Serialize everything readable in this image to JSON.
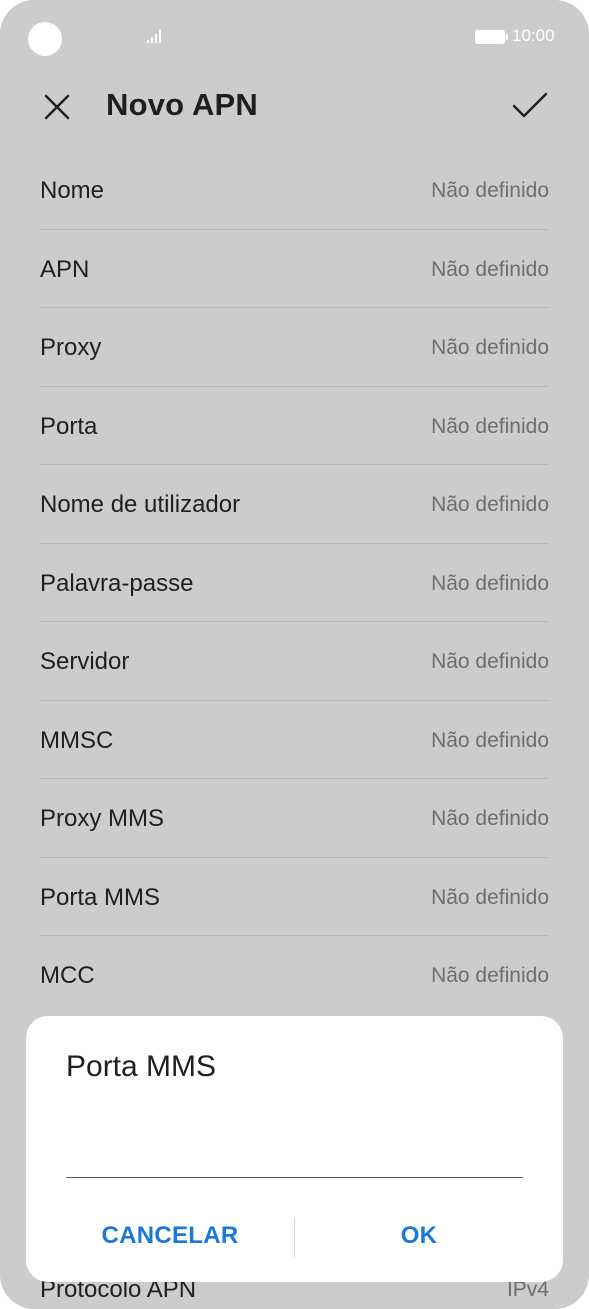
{
  "status_bar": {
    "time": "10:00",
    "signal_icon": "signal-bars-icon",
    "battery_icon": "battery-icon"
  },
  "header": {
    "title": "Novo APN",
    "close_icon": "close-icon",
    "confirm_icon": "checkmark-icon"
  },
  "apn_fields": [
    {
      "label": "Nome",
      "value": "Não definido"
    },
    {
      "label": "APN",
      "value": "Não definido"
    },
    {
      "label": "Proxy",
      "value": "Não definido"
    },
    {
      "label": "Porta",
      "value": "Não definido"
    },
    {
      "label": "Nome de utilizador",
      "value": "Não definido"
    },
    {
      "label": "Palavra-passe",
      "value": "Não definido"
    },
    {
      "label": "Servidor",
      "value": "Não definido"
    },
    {
      "label": "MMSC",
      "value": "Não definido"
    },
    {
      "label": "Proxy MMS",
      "value": "Não definido"
    },
    {
      "label": "Porta MMS",
      "value": "Não definido"
    },
    {
      "label": "MCC",
      "value": "Não definido"
    }
  ],
  "bottom_field": {
    "label": "Protocolo APN",
    "value": "IPv4"
  },
  "dialog": {
    "title": "Porta MMS",
    "input_value": "",
    "cancel_label": "CANCELAR",
    "ok_label": "OK"
  },
  "colors": {
    "accent": "#1a78d8",
    "overlay_background": "#cccccc"
  }
}
